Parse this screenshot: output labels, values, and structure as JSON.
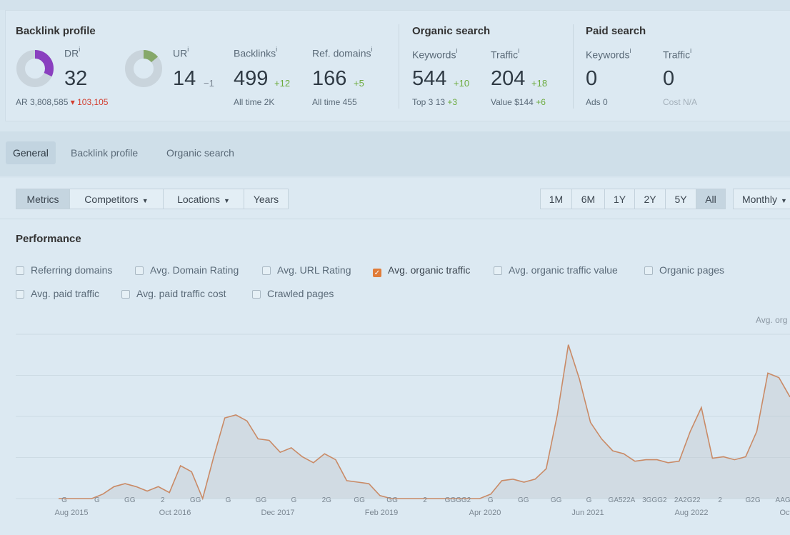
{
  "backlink_profile": {
    "title": "Backlink profile",
    "dr": {
      "label": "DR",
      "info": "i",
      "value": "32",
      "fraction": 0.32,
      "color": "#8a3fbf"
    },
    "ur": {
      "label": "UR",
      "info": "i",
      "value": "14",
      "delta": "−1",
      "fraction": 0.14,
      "color": "#86a86a"
    },
    "ar": {
      "text": "AR 3,808,585",
      "delta": "▾ 103,105"
    },
    "backlinks": {
      "label": "Backlinks",
      "info": "i",
      "value": "499",
      "delta": "+12",
      "sub": "All time 2K"
    },
    "ref_domains": {
      "label": "Ref. domains",
      "info": "i",
      "value": "166",
      "delta": "+5",
      "sub": "All time 455"
    }
  },
  "organic_search": {
    "title": "Organic search",
    "keywords": {
      "label": "Keywords",
      "info": "i",
      "value": "544",
      "delta": "+10",
      "sub": "Top 3 13",
      "sub_delta": "+3"
    },
    "traffic": {
      "label": "Traffic",
      "info": "i",
      "value": "204",
      "delta": "+18",
      "sub": "Value $144",
      "sub_delta": "+6"
    }
  },
  "paid_search": {
    "title": "Paid search",
    "keywords": {
      "label": "Keywords",
      "info": "i",
      "value": "0",
      "sub": "Ads 0"
    },
    "traffic": {
      "label": "Traffic",
      "info": "i",
      "value": "0",
      "sub": "Cost N/A"
    }
  },
  "tabs": [
    "General",
    "Backlink profile",
    "Organic search"
  ],
  "toolbar": {
    "metrics": "Metrics",
    "competitors": "Competitors",
    "locations": "Locations",
    "years": "Years",
    "ranges": [
      "1M",
      "6M",
      "1Y",
      "2Y",
      "5Y",
      "All"
    ],
    "active_range": "All",
    "interval": "Monthly"
  },
  "performance": {
    "title": "Performance",
    "checkboxes": [
      {
        "label": "Referring domains",
        "checked": false
      },
      {
        "label": "Avg. Domain Rating",
        "checked": false
      },
      {
        "label": "Avg. URL Rating",
        "checked": false
      },
      {
        "label": "Avg. organic traffic",
        "checked": true
      },
      {
        "label": "Avg. organic traffic value",
        "checked": false
      },
      {
        "label": "Organic pages",
        "checked": false
      },
      {
        "label": "Avg. paid traffic",
        "checked": false
      },
      {
        "label": "Avg. paid traffic cost",
        "checked": false
      },
      {
        "label": "Crawled pages",
        "checked": false
      }
    ]
  },
  "chart_data": {
    "type": "area",
    "series": [
      {
        "name": "Avg. org",
        "color": "#c98a66",
        "fill": "#c4c9d0"
      }
    ],
    "x_tick_labels": [
      "Aug 2015",
      "Oct 2016",
      "Dec 2017",
      "Feb 2019",
      "Apr 2020",
      "Jun 2021",
      "Aug 2022",
      "Oct"
    ],
    "ylim": [
      0,
      100
    ],
    "grid": true,
    "x": [
      "2015-08",
      "2015-10",
      "2015-12",
      "2016-02",
      "2016-04",
      "2016-06",
      "2016-08",
      "2016-09",
      "2016-10",
      "2016-11",
      "2016-12",
      "2017-01",
      "2017-03",
      "2017-05",
      "2017-06",
      "2017-08",
      "2017-09",
      "2017-11",
      "2018-01",
      "2018-02",
      "2018-04",
      "2018-06",
      "2018-07",
      "2018-09",
      "2018-11",
      "2019-01",
      "2019-03",
      "2019-05",
      "2019-07",
      "2019-09",
      "2019-11",
      "2020-01",
      "2020-03",
      "2020-05",
      "2020-07",
      "2020-09",
      "2020-11",
      "2021-01",
      "2021-02",
      "2021-03",
      "2021-04",
      "2021-05",
      "2021-06",
      "2021-07",
      "2021-08",
      "2021-09",
      "2021-10",
      "2021-11",
      "2021-12",
      "2022-01",
      "2022-02",
      "2022-03",
      "2022-04",
      "2022-05",
      "2022-06",
      "2022-07",
      "2022-08",
      "2022-09",
      "2022-10",
      "2022-11",
      "2022-12",
      "2023-01"
    ],
    "values": [
      0,
      0,
      0,
      0,
      3,
      8,
      10,
      8,
      5,
      8,
      4,
      22,
      18,
      0,
      28,
      54,
      56,
      52,
      40,
      39,
      31,
      34,
      28,
      24,
      30,
      26,
      12,
      11,
      10,
      2,
      0,
      0,
      0,
      0,
      0,
      0,
      0,
      0,
      0,
      3,
      12,
      13,
      11,
      13,
      20,
      56,
      103,
      80,
      51,
      40,
      32,
      30,
      25,
      26,
      26,
      24,
      25,
      45,
      61,
      27,
      28,
      26,
      28,
      45,
      84,
      81,
      68
    ]
  },
  "chart_annotations": [
    "G",
    "G",
    "GG",
    "2",
    "GG",
    "G",
    "GG",
    "G",
    "2G",
    "GG",
    "GG",
    "2",
    "GGGG2",
    "G",
    "GG",
    "GG",
    "G",
    "GA522A",
    "3GGG2",
    "2A2G22",
    "2",
    "G2G",
    "AAGG"
  ]
}
